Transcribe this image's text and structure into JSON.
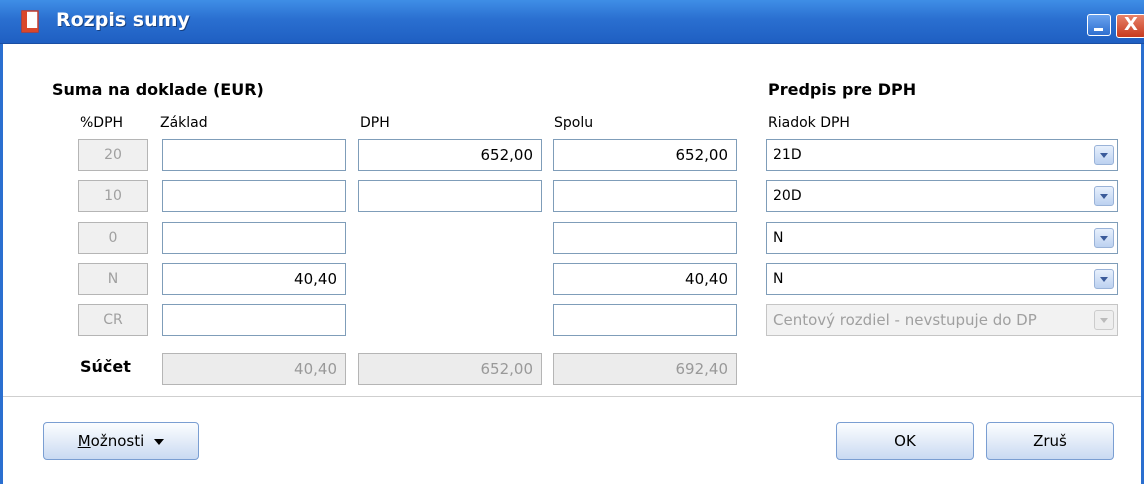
{
  "window": {
    "title": "Rozpis sumy",
    "close_glyph": "X"
  },
  "left": {
    "header": "Suma na doklade (EUR)",
    "col_rate": "%DPH",
    "col_base": "Základ",
    "col_vat": "DPH",
    "col_total": "Spolu",
    "rows": [
      {
        "rate": "20",
        "base": "",
        "vat": "652,00",
        "total": "652,00"
      },
      {
        "rate": "10",
        "base": "",
        "vat": "",
        "total": ""
      },
      {
        "rate": "0",
        "base": "",
        "total": ""
      },
      {
        "rate": "N",
        "base": "40,40",
        "total": "40,40"
      },
      {
        "rate": "CR",
        "base": "",
        "total": ""
      }
    ],
    "sum_label": "Súčet",
    "sum": {
      "base": "40,40",
      "vat": "652,00",
      "total": "692,40"
    }
  },
  "right": {
    "header": "Predpis pre DPH",
    "col_label": "Riadok DPH",
    "combos": [
      "21D",
      "20D",
      "N",
      "N",
      "Centový rozdiel - nevstupuje do DP"
    ]
  },
  "buttons": {
    "options_prefix": "M",
    "options_rest": "ožnosti",
    "ok": "OK",
    "cancel": "Zruš"
  },
  "colors": {
    "titlebar": "#2a6fd0",
    "field_border": "#7f9db9",
    "button_border": "#7a9ed2"
  },
  "icons": {
    "app": "document-icon",
    "minimize": "minimize-icon",
    "close": "close-icon",
    "dropdown": "chevron-down-icon"
  }
}
